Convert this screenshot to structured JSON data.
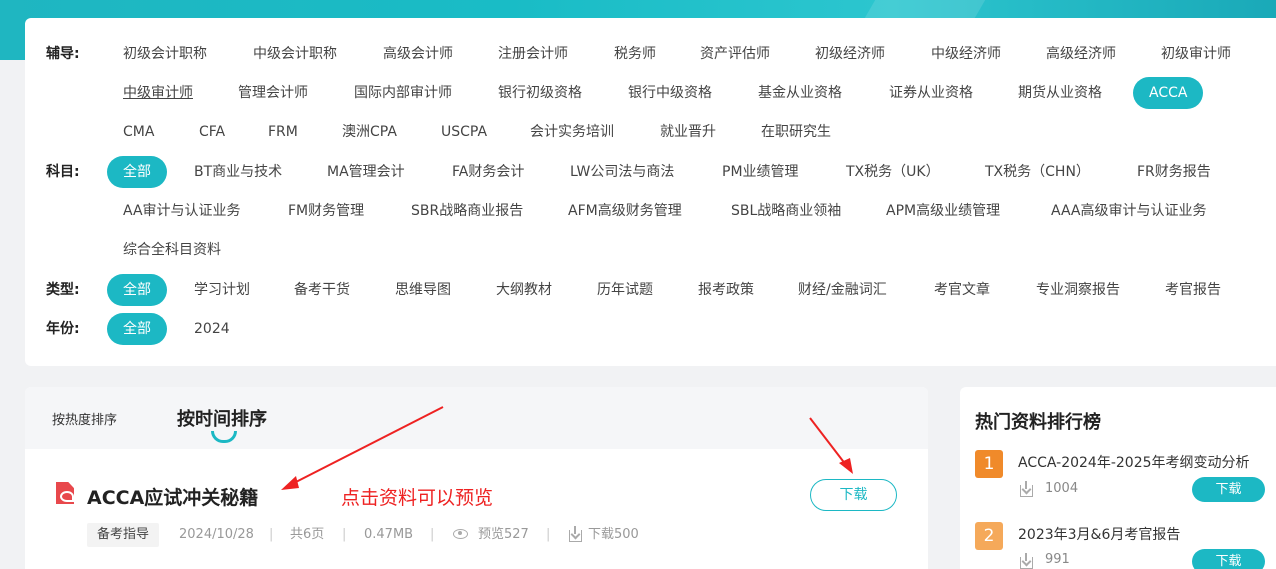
{
  "filters": {
    "fudao": {
      "label": "辅导:",
      "rows": [
        [
          "初级会计职称",
          "中级会计职称",
          "高级会计师",
          "注册会计师",
          "税务师",
          "资产评估师",
          "初级经济师",
          "中级经济师",
          "高级经济师",
          "初级审计师"
        ],
        [
          "中级审计师",
          "管理会计师",
          "国际内部审计师",
          "银行初级资格",
          "银行中级资格",
          "基金从业资格",
          "证券从业资格",
          "期货从业资格",
          "ACCA"
        ],
        [
          "CMA",
          "CFA",
          "FRM",
          "澳洲CPA",
          "USCPA",
          "会计实务培训",
          "就业晋升",
          "在职研究生"
        ]
      ],
      "active": "ACCA",
      "hovered": "中级审计师"
    },
    "kemu": {
      "label": "科目:",
      "rows": [
        [
          "全部",
          "BT商业与技术",
          "MA管理会计",
          "FA财务会计",
          "LW公司法与商法",
          "PM业绩管理",
          "TX税务（UK）",
          "TX税务（CHN）",
          "FR财务报告"
        ],
        [
          "AA审计与认证业务",
          "FM财务管理",
          "SBR战略商业报告",
          "AFM高级财务管理",
          "SBL战略商业领袖",
          "APM高级业绩管理",
          "AAA高级审计与认证业务"
        ],
        [
          "综合全科目资料"
        ]
      ],
      "active": "全部"
    },
    "leixing": {
      "label": "类型:",
      "options": [
        "全部",
        "学习计划",
        "备考干货",
        "思维导图",
        "大纲教材",
        "历年试题",
        "报考政策",
        "财经/金融词汇",
        "考官文章",
        "专业洞察报告",
        "考官报告"
      ],
      "active": "全部"
    },
    "nianfen": {
      "label": "年份:",
      "options": [
        "全部",
        "2024"
      ],
      "active": "全部"
    }
  },
  "sort": {
    "hot_label": "按热度排序",
    "time_label": "按时间排序"
  },
  "item": {
    "title": "ACCA应试冲关秘籍",
    "hint": "点击资料可以预览",
    "download_label": "下载",
    "tag": "备考指导",
    "date": "2024/10/28",
    "pages": "共6页",
    "size": "0.47MB",
    "preview": "预览527",
    "downloads": "下载500"
  },
  "ranking": {
    "title": "热门资料排行榜",
    "items": [
      {
        "rank": "1",
        "name": "ACCA-2024年-2025年考纲变动分析",
        "count": "1004",
        "download_label": "下载",
        "color": "#f08a2a"
      },
      {
        "rank": "2",
        "name": "2023年3月&6月考官报告",
        "count": "991",
        "download_label": "下载",
        "color": "#f5a95a"
      }
    ]
  },
  "colors": {
    "accent": "#1cb8c4",
    "annotation": "#ee2222"
  }
}
